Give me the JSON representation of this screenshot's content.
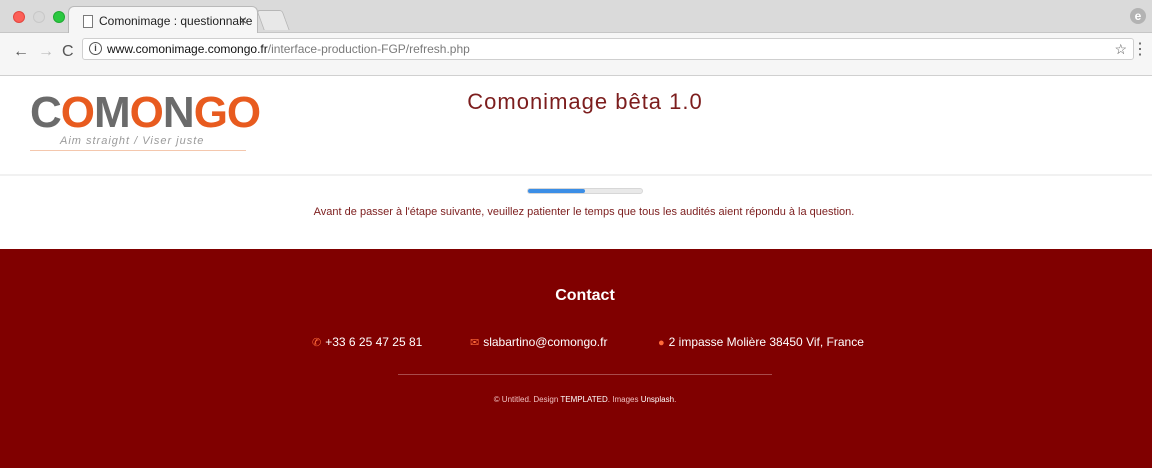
{
  "browser": {
    "tab_title": "Comonimage : questionnaire",
    "tab_close": "×",
    "url_host": "www.comonimage.comongo.fr",
    "url_path": "/interface-production-FGP/refresh.php",
    "info_glyph": "i",
    "star_glyph": "☆",
    "menu_glyph": "⋮",
    "back_glyph": "←",
    "forward_glyph": "→",
    "reload_glyph": "C",
    "profile_glyph": "e"
  },
  "header": {
    "logo_text": "COMONGO",
    "logo_tagline": "Aim straight / Viser juste",
    "app_title": "Comonimage bêta 1.0"
  },
  "main": {
    "progress_fraction": 0.5,
    "wait_message": "Avant de passer à l'étape suivante, veuillez patienter le temps que tous les audités aient répondu à la question."
  },
  "footer": {
    "heading": "Contact",
    "phone": "+33 6 25 47 25 81",
    "email": "slabartino@comongo.fr",
    "address": "2 impasse Molière 38450 Vif, France",
    "credits_copyright": "© Untitled. Design",
    "credits_templated": "TEMPLATED",
    "credits_images": ". Images",
    "credits_unsplash": "Unsplash",
    "credits_end": "."
  },
  "colors": {
    "brand_red": "#800000",
    "logo_orange": "#e85b1f",
    "progress_blue": "#3b8ee6"
  },
  "icons": {
    "phone": "phone-icon",
    "email": "envelope-icon",
    "address": "map-marker-icon"
  }
}
